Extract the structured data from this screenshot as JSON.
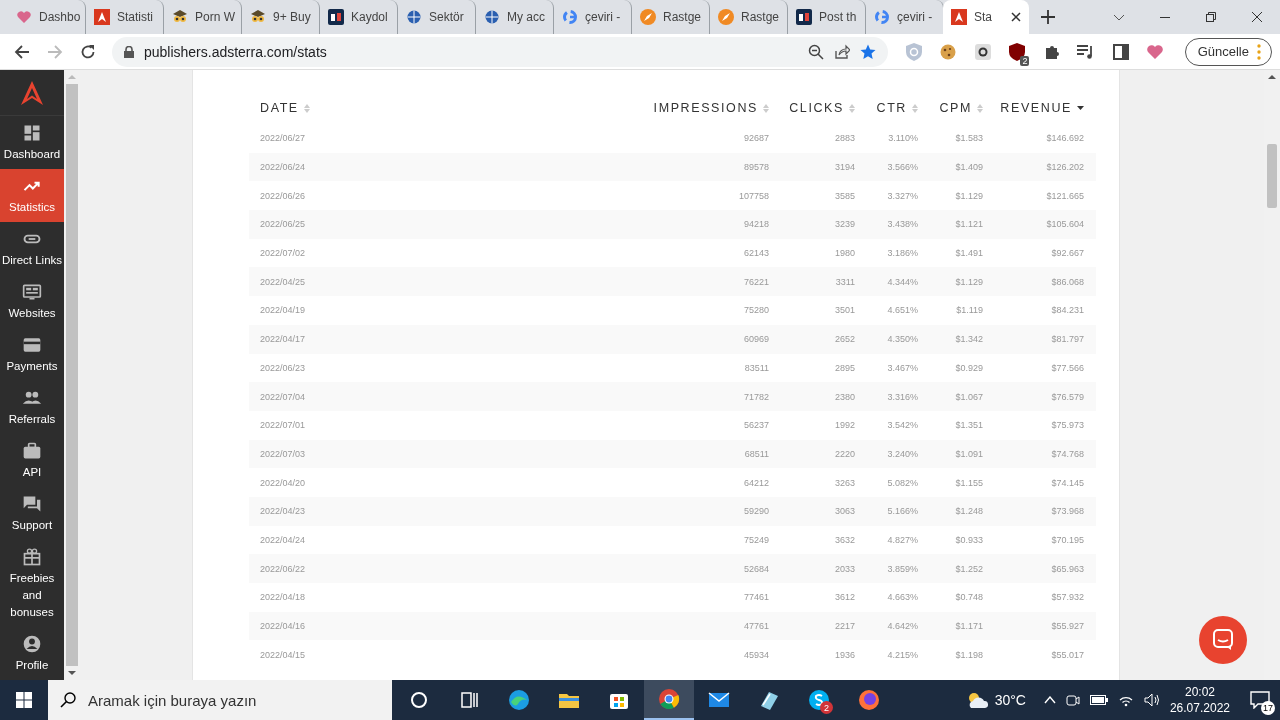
{
  "browser": {
    "tabs": [
      {
        "title": "Dashbo",
        "kind": "heart",
        "selected": false
      },
      {
        "title": "Statisti",
        "kind": "adsterra",
        "selected": false
      },
      {
        "title": "Porn W",
        "kind": "owl",
        "selected": false
      },
      {
        "title": "9+ Buy",
        "kind": "owl",
        "selected": false
      },
      {
        "title": "Kaydol",
        "kind": "np",
        "selected": false
      },
      {
        "title": "Sektör",
        "kind": "globe",
        "selected": false
      },
      {
        "title": "My acc",
        "kind": "globe",
        "selected": false
      },
      {
        "title": "çeviri -",
        "kind": "google",
        "selected": false
      },
      {
        "title": "Rastge",
        "kind": "rocket",
        "selected": false
      },
      {
        "title": "Rastge",
        "kind": "rocket",
        "selected": false
      },
      {
        "title": "Post th",
        "kind": "np",
        "selected": false
      },
      {
        "title": "çeviri -",
        "kind": "google",
        "selected": false
      },
      {
        "title": "Sta",
        "kind": "adsterra",
        "selected": true
      }
    ],
    "url": "publishers.adsterra.com/stats",
    "extension_badge": "2",
    "update_button": "Güncelle"
  },
  "sidebar": {
    "items": [
      {
        "label": "Dashboard",
        "kind": "dashboard",
        "selected": false
      },
      {
        "label": "Statistics",
        "kind": "trend",
        "selected": true
      },
      {
        "label": "Direct Links",
        "kind": "link",
        "selected": false
      },
      {
        "label": "Websites",
        "kind": "website",
        "selected": false
      },
      {
        "label": "Payments",
        "kind": "card",
        "selected": false
      },
      {
        "label": "Referrals",
        "kind": "people",
        "selected": false
      },
      {
        "label": "API",
        "kind": "briefcase",
        "selected": false
      },
      {
        "label": "Support",
        "kind": "chat",
        "selected": false
      },
      {
        "label": "Freebies and bonuses",
        "kind": "gift",
        "selected": false
      },
      {
        "label": "Profile",
        "kind": "person",
        "selected": false
      }
    ]
  },
  "table": {
    "columns": [
      {
        "label": "DATE",
        "sorted": false
      },
      {
        "label": "IMPRESSIONS",
        "sorted": false
      },
      {
        "label": "CLICKS",
        "sorted": false
      },
      {
        "label": "CTR",
        "sorted": false
      },
      {
        "label": "CPM",
        "sorted": false
      },
      {
        "label": "REVENUE",
        "sorted": true
      }
    ],
    "rows": [
      [
        "2022/06/27",
        "92687",
        "2883",
        "3.110%",
        "$1.583",
        "$146.692"
      ],
      [
        "2022/06/24",
        "89578",
        "3194",
        "3.566%",
        "$1.409",
        "$126.202"
      ],
      [
        "2022/06/26",
        "107758",
        "3585",
        "3.327%",
        "$1.129",
        "$121.665"
      ],
      [
        "2022/06/25",
        "94218",
        "3239",
        "3.438%",
        "$1.121",
        "$105.604"
      ],
      [
        "2022/07/02",
        "62143",
        "1980",
        "3.186%",
        "$1.491",
        "$92.667"
      ],
      [
        "2022/04/25",
        "76221",
        "3311",
        "4.344%",
        "$1.129",
        "$86.068"
      ],
      [
        "2022/04/19",
        "75280",
        "3501",
        "4.651%",
        "$1.119",
        "$84.231"
      ],
      [
        "2022/04/17",
        "60969",
        "2652",
        "4.350%",
        "$1.342",
        "$81.797"
      ],
      [
        "2022/06/23",
        "83511",
        "2895",
        "3.467%",
        "$0.929",
        "$77.566"
      ],
      [
        "2022/07/04",
        "71782",
        "2380",
        "3.316%",
        "$1.067",
        "$76.579"
      ],
      [
        "2022/07/01",
        "56237",
        "1992",
        "3.542%",
        "$1.351",
        "$75.973"
      ],
      [
        "2022/07/03",
        "68511",
        "2220",
        "3.240%",
        "$1.091",
        "$74.768"
      ],
      [
        "2022/04/20",
        "64212",
        "3263",
        "5.082%",
        "$1.155",
        "$74.145"
      ],
      [
        "2022/04/23",
        "59290",
        "3063",
        "5.166%",
        "$1.248",
        "$73.968"
      ],
      [
        "2022/04/24",
        "75249",
        "3632",
        "4.827%",
        "$0.933",
        "$70.195"
      ],
      [
        "2022/06/22",
        "52684",
        "2033",
        "3.859%",
        "$1.252",
        "$65.963"
      ],
      [
        "2022/04/18",
        "77461",
        "3612",
        "4.663%",
        "$0.748",
        "$57.932"
      ],
      [
        "2022/04/16",
        "47761",
        "2217",
        "4.642%",
        "$1.171",
        "$55.927"
      ],
      [
        "2022/04/15",
        "45934",
        "1936",
        "4.215%",
        "$1.198",
        "$55.017"
      ]
    ]
  },
  "taskbar": {
    "search": {
      "placeholder": "Aramak için buraya yazın"
    },
    "apps": [
      {
        "kind": "cortana",
        "selected": false
      },
      {
        "kind": "taskview",
        "selected": false
      },
      {
        "kind": "edge",
        "selected": false
      },
      {
        "kind": "folder",
        "selected": false
      },
      {
        "kind": "store",
        "selected": false
      },
      {
        "kind": "chrome",
        "selected": true
      },
      {
        "kind": "mail",
        "selected": false
      },
      {
        "kind": "notes",
        "selected": false
      },
      {
        "kind": "skype",
        "selected": false,
        "badge": "2"
      },
      {
        "kind": "firefox",
        "selected": false
      }
    ],
    "weather": "30°C",
    "time": "20:02",
    "date": "26.07.2022",
    "notifications": "17"
  }
}
